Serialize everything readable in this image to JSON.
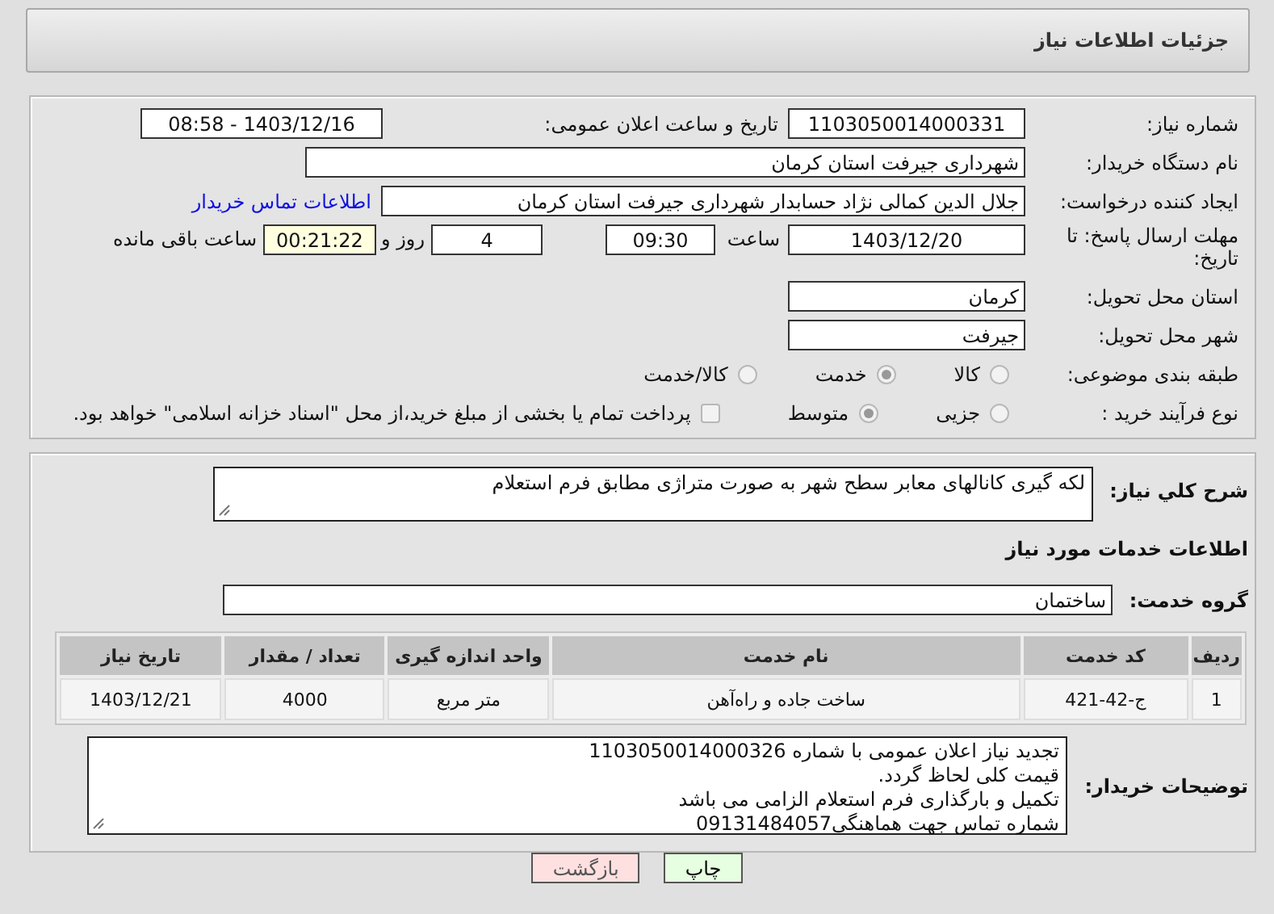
{
  "header": {
    "title": "جزئیات اطلاعات نیاز"
  },
  "details": {
    "need_number": {
      "label": "شماره نیاز:",
      "value": "1103050014000331"
    },
    "announce": {
      "label": "تاریخ و ساعت اعلان عمومی:",
      "value": "1403/12/16 - 08:58"
    },
    "buyer": {
      "label": "نام دستگاه خریدار:",
      "value": "شهرداری جیرفت استان کرمان"
    },
    "creator": {
      "label": "ایجاد کننده درخواست:",
      "value": "جلال الدین کمالی نژاد حسابدار شهرداری جیرفت استان کرمان",
      "link": "اطلاعات تماس خریدار"
    },
    "deadline": {
      "label": "مهلت ارسال پاسخ: تا تاریخ:",
      "date": "1403/12/20",
      "time_label": "ساعت",
      "time": "09:30",
      "days": "4",
      "days_label": "روز و",
      "remaining": "00:21:22",
      "remaining_label": "ساعت باقی مانده"
    },
    "province": {
      "label": "استان محل تحویل:",
      "value": "کرمان"
    },
    "city": {
      "label": "شهر محل تحویل:",
      "value": "جیرفت"
    },
    "category": {
      "label": "طبقه بندی موضوعی:",
      "options": [
        {
          "label": "کالا",
          "selected": false
        },
        {
          "label": "خدمت",
          "selected": true
        },
        {
          "label": "کالا/خدمت",
          "selected": false
        }
      ]
    },
    "process": {
      "label": "نوع فرآیند خرید :",
      "options": [
        {
          "label": "جزیی",
          "selected": false
        },
        {
          "label": "متوسط",
          "selected": true
        }
      ],
      "payment": {
        "label": "پرداخت تمام یا بخشی از مبلغ خرید،از محل \"اسناد خزانه اسلامی\" خواهد بود.",
        "checked": false
      }
    }
  },
  "needs": {
    "summary_label": "شرح کلي نیاز:",
    "summary": "لکه گیری کانالهای معابر سطح شهر به صورت متراژی مطابق فرم استعلام",
    "services_heading": "اطلاعات خدمات مورد نیاز",
    "group_label": "گروه خدمت:",
    "group": "ساختمان",
    "table": {
      "columns": [
        "ردیف",
        "کد خدمت",
        "نام خدمت",
        "واحد اندازه گیری",
        "تعداد / مقدار",
        "تاریخ نیاز"
      ],
      "rows": [
        [
          "1",
          "ج-42-421",
          "ساخت جاده و راه‌آهن",
          "متر مربع",
          "4000",
          "1403/12/21"
        ]
      ]
    },
    "notes_label": "توضیحات خریدار:",
    "notes": [
      "تجدید نیاز اعلان عمومی با شماره 1103050014000326",
      "قیمت کلی لحاظ گردد.",
      "تکمیل و بارگذاری فرم استعلام الزامی می باشد",
      "شماره تماس جهت هماهنگی09131484057"
    ]
  },
  "buttons": [
    {
      "label": "چاپ",
      "kind": "print"
    },
    {
      "label": "بازگشت",
      "kind": "back"
    }
  ]
}
